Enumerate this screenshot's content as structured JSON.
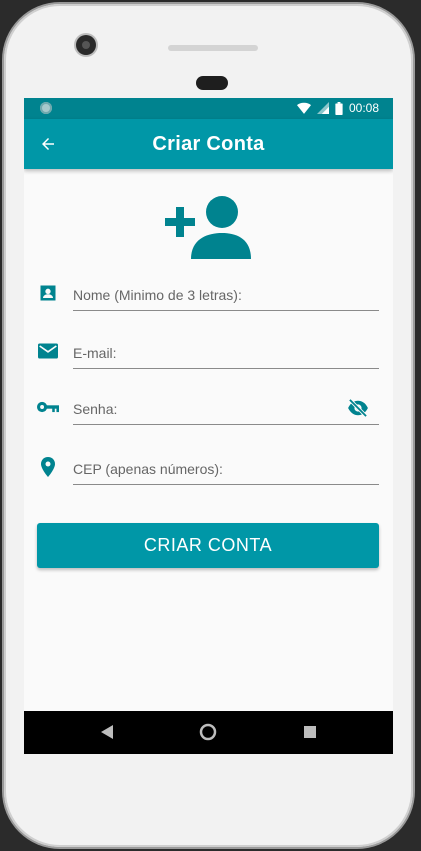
{
  "status_bar": {
    "time": "00:08"
  },
  "app_bar": {
    "title": "Criar Conta",
    "back_icon": "arrow-back-icon"
  },
  "hero": {
    "icon": "person-add-icon"
  },
  "form": {
    "fields": [
      {
        "icon": "contact-card-icon",
        "placeholder": "Nome (Minimo de 3 letras):",
        "value": ""
      },
      {
        "icon": "email-icon",
        "placeholder": "E-mail:",
        "value": ""
      },
      {
        "icon": "key-icon",
        "placeholder": "Senha:",
        "value": "",
        "toggle_icon": "visibility-off-icon"
      },
      {
        "icon": "location-pin-icon",
        "placeholder": "CEP (apenas números):",
        "value": ""
      }
    ],
    "submit_label": "CRIAR CONTA"
  },
  "navigation": {
    "back": "nav-back-icon",
    "home": "nav-home-icon",
    "recents": "nav-recents-icon"
  },
  "colors": {
    "primary": "#0097a7",
    "primary_dark": "#00838f",
    "icon": "#00838f"
  }
}
